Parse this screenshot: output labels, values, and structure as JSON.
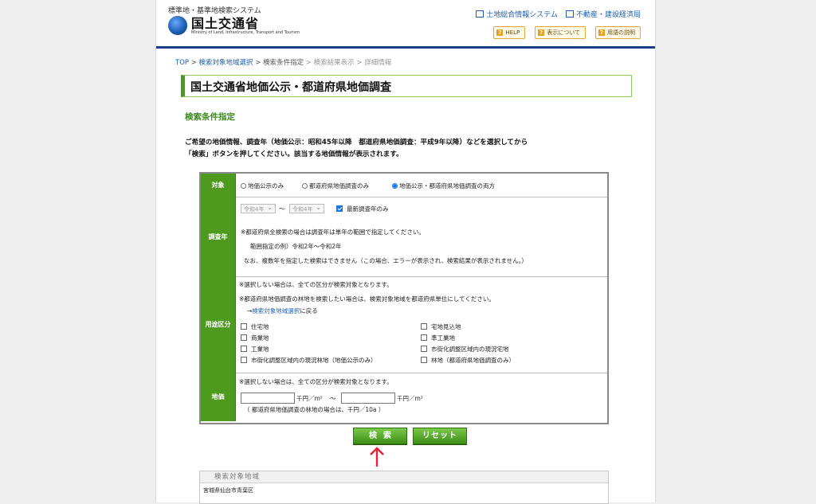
{
  "header": {
    "system_name": "標準地・基準地検索システム",
    "logo_ja": "国土交通省",
    "logo_en": "Ministry of Land, Infrastructure, Transport and Tourism",
    "links": [
      "土地総合情報システム",
      "不動産・建設経済局"
    ],
    "help_buttons": [
      "HELP",
      "表示について",
      "用語の説明"
    ]
  },
  "breadcrumb": {
    "top": "TOP",
    "sep": " > ",
    "area": "検索対象地域選択",
    "current": "検索条件指定",
    "results": "検索結果表示",
    "detail": "詳細情報"
  },
  "page_title": "国土交通省地価公示・都道府県地価調査",
  "section_title": "検索条件指定",
  "intro": {
    "line1": "ご希望の地価情報、調査年（地価公示：昭和45年以降　都道府県地価調査：平成9年以降）などを選択してから",
    "line2": "「検索」ボタンを押してください。該当する地価情報が表示されます。"
  },
  "form": {
    "target": {
      "label": "対象",
      "options": [
        "地価公示のみ",
        "都道府県地価調査のみ",
        "地価公示・都道府県地価調査の両方"
      ],
      "selected_index": 2
    },
    "year": {
      "label": "調査年",
      "from": "令和4年",
      "tilde": "〜",
      "to": "令和4年",
      "latest_only_label": "最新調査年のみ",
      "latest_only_checked": true,
      "note1": "※都道府県全検索の場合は調査年は単年の範囲で指定してください。",
      "note2": "範囲指定の例）令和2年〜令和2年",
      "note3": "なお、複数年を指定した検索はできません（この場合、エラーが表示され、検索結果が表示されません。）"
    },
    "use": {
      "label": "用途区分",
      "note1": "※選択しない場合は、全ての区分が検索対象となります。",
      "note2": "※都道府県地価調査の林地を検索したい場合は、検索対象地域を都道府県単位にしてください。",
      "back_arrow": "→",
      "back_link": "検索対象地域選択",
      "back_suffix": "に戻る",
      "left_items": [
        "住宅地",
        "商業地",
        "工業地",
        "市街化調整区域内の現況林地（地価公示のみ）"
      ],
      "right_items": [
        "宅地見込地",
        "準工業地",
        "市街化調整区域内の現況宅地",
        "林地（都道府県地価調査のみ）"
      ]
    },
    "price": {
      "label": "地価",
      "note": "※選択しない場合は、全ての区分が検索対象となります。",
      "unit1": "千円／m²",
      "tilde": "〜",
      "unit2": "千円／m²",
      "forest_note": "（ 都道府県地価調査の林地の場合は、千円／10a ）",
      "min_value": "",
      "max_value": ""
    }
  },
  "buttons": {
    "search": "検索",
    "reset": "リセット"
  },
  "results": {
    "header": "検索対象地域",
    "value": "宮城県仙台市青葉区"
  },
  "colors": {
    "accent_green": "#4e9a1e",
    "nav_blue": "#1b3f86",
    "arrow_red": "#e8213a"
  }
}
